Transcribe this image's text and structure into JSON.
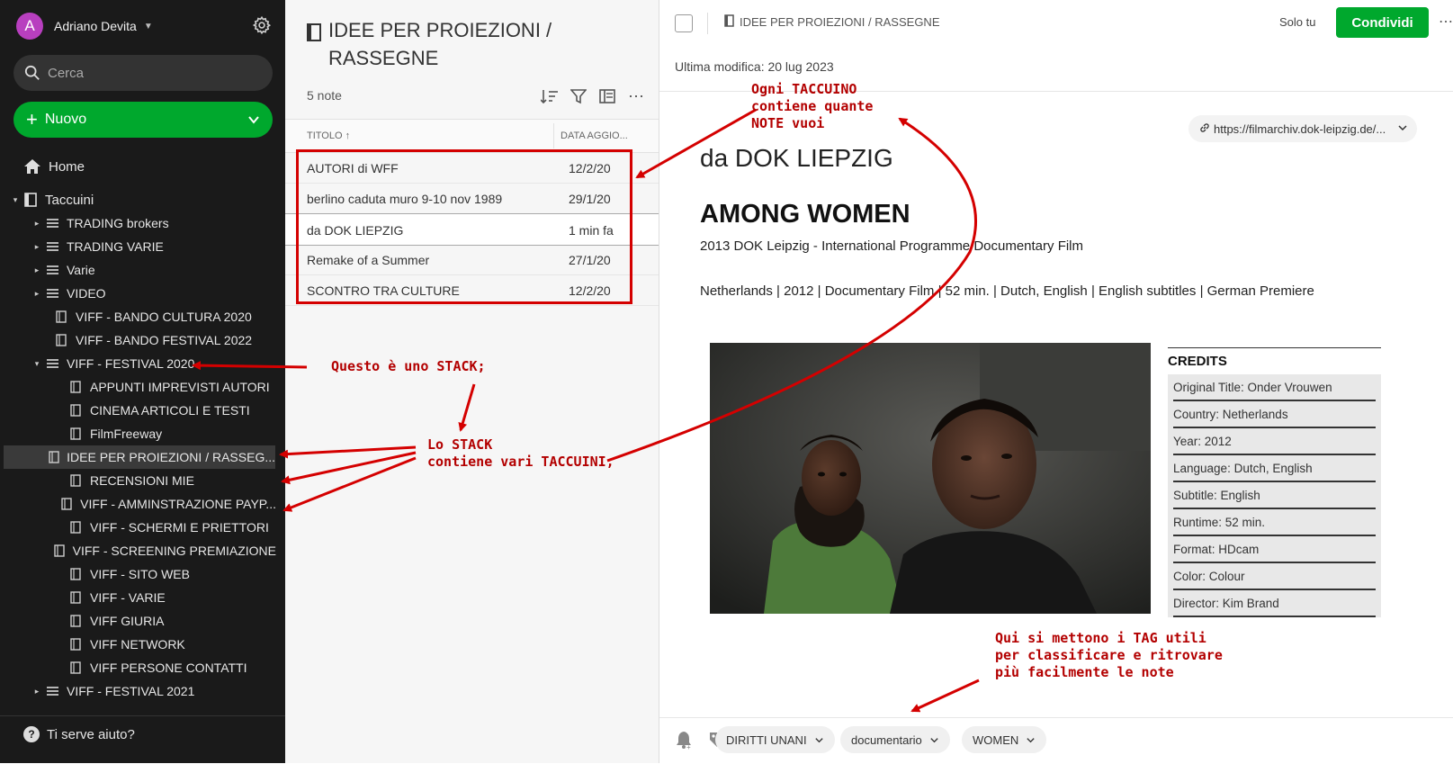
{
  "account": {
    "initial": "A",
    "name": "Adriano Devita"
  },
  "search": {
    "placeholder": "Cerca"
  },
  "new_button": {
    "label": "Nuovo"
  },
  "home": {
    "label": "Home"
  },
  "tree": [
    {
      "label": "Taccuini",
      "kind": "root"
    },
    {
      "label": "TRADING brokers",
      "kind": "stack"
    },
    {
      "label": "TRADING VARIE",
      "kind": "stack"
    },
    {
      "label": "Varie",
      "kind": "stack"
    },
    {
      "label": "VIDEO",
      "kind": "stack"
    },
    {
      "label": "VIFF - BANDO CULTURA 2020",
      "kind": "notebook"
    },
    {
      "label": "VIFF - BANDO FESTIVAL 2022",
      "kind": "notebook"
    },
    {
      "label": "VIFF - FESTIVAL 2020",
      "kind": "stack-open"
    },
    {
      "label": "APPUNTI IMPREVISTI AUTORI",
      "kind": "child"
    },
    {
      "label": "CINEMA ARTICOLI E TESTI",
      "kind": "child"
    },
    {
      "label": "FilmFreeway",
      "kind": "child"
    },
    {
      "label": "IDEE PER PROIEZIONI / RASSEG...",
      "kind": "child-selected"
    },
    {
      "label": "RECENSIONI MIE",
      "kind": "child"
    },
    {
      "label": "VIFF - AMMINSTRAZIONE PAYP...",
      "kind": "child"
    },
    {
      "label": "VIFF - SCHERMI E PRIETTORI",
      "kind": "child"
    },
    {
      "label": "VIFF - SCREENING PREMIAZIONE",
      "kind": "child"
    },
    {
      "label": "VIFF - SITO WEB",
      "kind": "child"
    },
    {
      "label": "VIFF - VARIE",
      "kind": "child"
    },
    {
      "label": "VIFF GIURIA",
      "kind": "child"
    },
    {
      "label": "VIFF NETWORK",
      "kind": "child"
    },
    {
      "label": "VIFF PERSONE CONTATTI",
      "kind": "child"
    },
    {
      "label": "VIFF - FESTIVAL 2021",
      "kind": "stack"
    }
  ],
  "help": {
    "label": "Ti serve aiuto?"
  },
  "notelist": {
    "title": "IDEE PER PROIEZIONI / RASSEGNE",
    "count": "5 note",
    "col_title": "TITOLO",
    "col_date": "DATA AGGIO...",
    "notes": [
      {
        "title": "AUTORI di WFF",
        "date": "12/2/20"
      },
      {
        "title": "berlino caduta muro 9-10 nov 1989",
        "date": "29/1/20"
      },
      {
        "title": "da DOK LIEPZIG",
        "date": "1 min fa"
      },
      {
        "title": "Remake of a Summer",
        "date": "27/1/20"
      },
      {
        "title": "SCONTRO TRA CULTURE",
        "date": "12/2/20"
      }
    ]
  },
  "editor": {
    "notebook": "IDEE PER PROIEZIONI / RASSEGNE",
    "visibility": "Solo tu",
    "share_label": "Condividi",
    "last_modified": "Ultima modifica: 20 lug 2023",
    "url": "https://filmarchiv.dok-leipzig.de/...",
    "heading": "da DOK LIEPZIG",
    "film_title": "AMONG WOMEN",
    "line1": "2013 DOK Leipzig - International Programme Documentary Film",
    "line2": "Netherlands | 2012 | Documentary Film | 52 min. | Dutch, English | English subtitles | German Premiere",
    "credits_title": "CREDITS",
    "credits": [
      "Original Title: Onder Vrouwen",
      "Country: Netherlands",
      "Year: 2012",
      "Language: Dutch, English",
      "Subtitle: English",
      "Runtime: 52 min.",
      "Format: HDcam",
      "Color: Colour",
      "Director: Kim Brand"
    ],
    "tags": [
      "DIRITTI UNANI",
      "documentario",
      "WOMEN"
    ]
  },
  "annotations": {
    "stack": "Questo è uno STACK;",
    "stack_contains_1": "Lo STACK",
    "stack_contains_2": "contiene vari TACCUINI,",
    "notebook_1": "Ogni TACCUINO",
    "notebook_2": "contiene quante",
    "notebook_3": "NOTE vuoi",
    "tags_1": "Qui si mettono i TAG utili",
    "tags_2": "per classificare e ritrovare",
    "tags_3": "più facilmente le note"
  },
  "colors": {
    "sidebar": "#1a1a1a",
    "accent_green": "#00a82d",
    "annotation_red": "#b30000",
    "avatar": "#b83fbf"
  }
}
